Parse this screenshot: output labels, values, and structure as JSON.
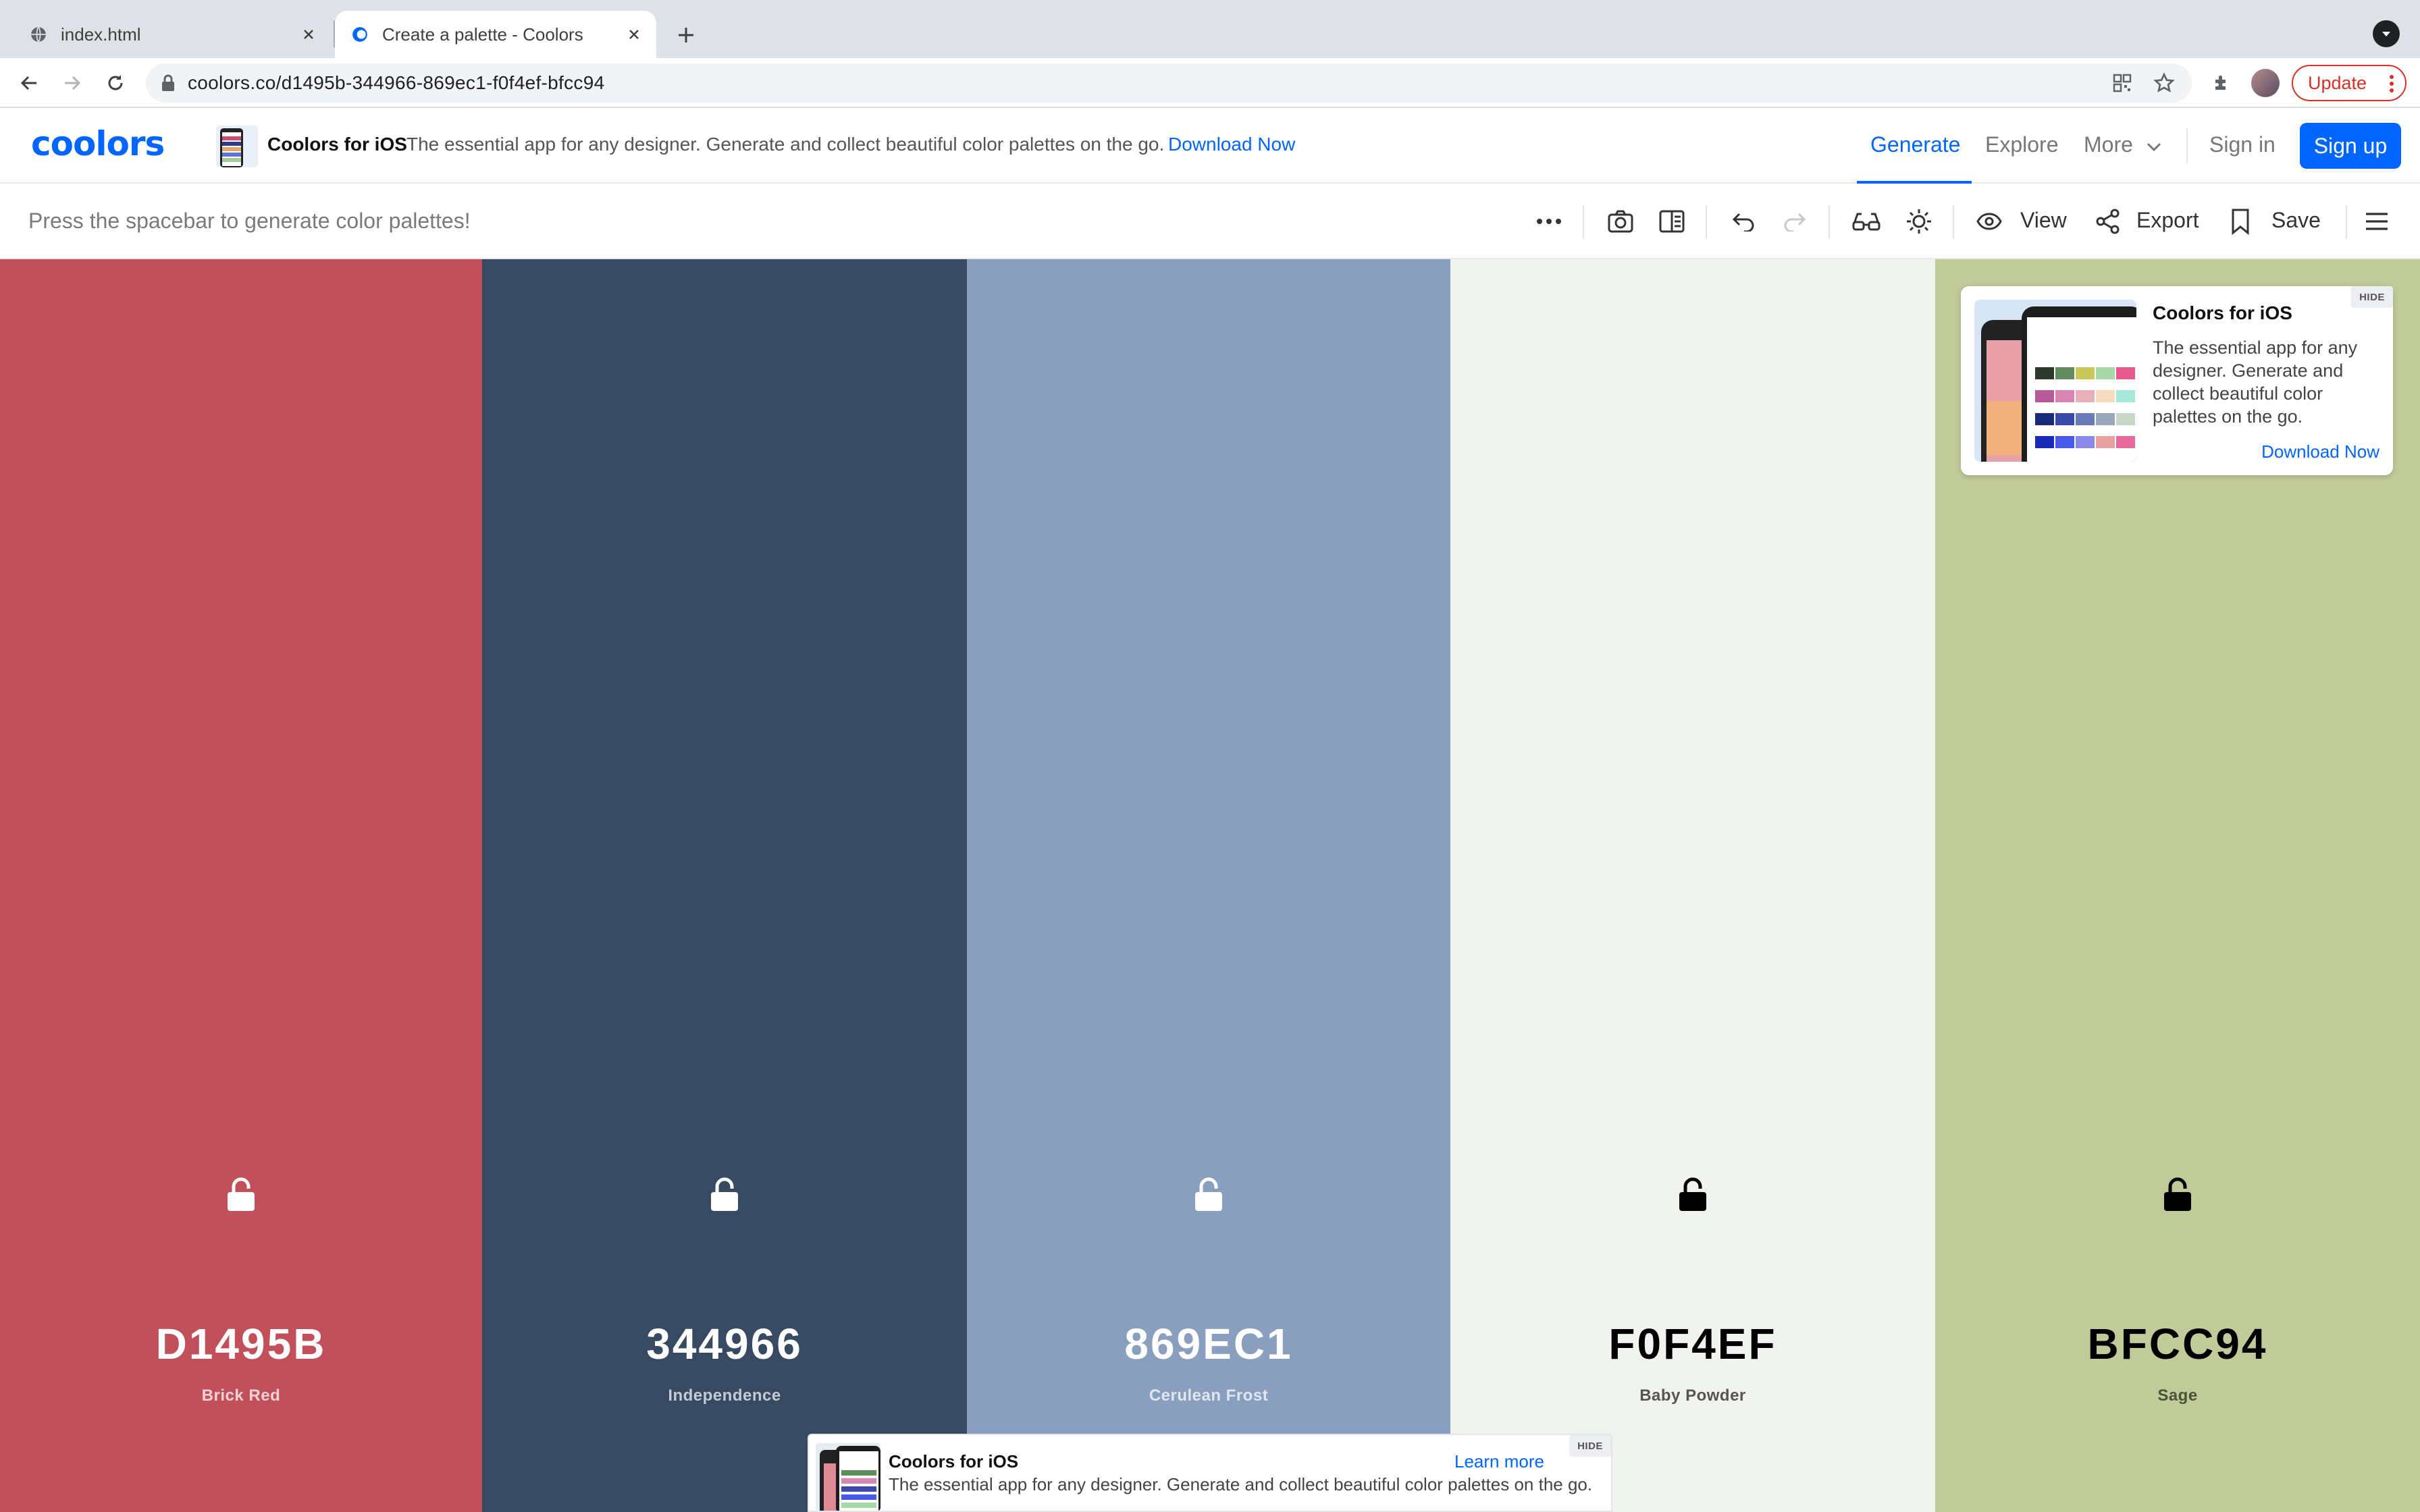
{
  "browser": {
    "tabs": [
      {
        "title": "index.html",
        "icon": "globe-icon",
        "active": false
      },
      {
        "title": "Create a palette - Coolors",
        "icon": "coolors-favicon",
        "active": true
      }
    ],
    "url": "coolors.co/d1495b-344966-869ec1-f0f4ef-bfcc94",
    "update_label": "Update"
  },
  "header": {
    "logo": "coolors",
    "promo": {
      "title": "Coolors for iOS",
      "description": "The essential app for any designer. Generate and collect beautiful color palettes on the go.",
      "link": "Download Now"
    },
    "nav": {
      "generate": "Generate",
      "explore": "Explore",
      "more": "More",
      "sign_in": "Sign in",
      "sign_up": "Sign up"
    },
    "accent_color": "#0066ff"
  },
  "toolbar": {
    "hint": "Press the spacebar to generate color palettes!",
    "view": "View",
    "export": "Export",
    "save": "Save"
  },
  "palette": [
    {
      "hex": "D1495B",
      "name": "Brick Red",
      "color": "#c2505b",
      "text_color": "#ffffff",
      "subtext_color": "#f1d2d5"
    },
    {
      "hex": "344966",
      "name": "Independence",
      "color": "#384962",
      "text_color": "#ffffff",
      "subtext_color": "#c4cbd6"
    },
    {
      "hex": "869EC1",
      "name": "Cerulean Frost",
      "color": "#8a9fbe",
      "text_color": "#ffffff",
      "subtext_color": "#dfe6f0"
    },
    {
      "hex": "F0F4EF",
      "name": "Baby Powder",
      "color": "#f1f3ef",
      "text_color": "#000000",
      "subtext_color": "#555555"
    },
    {
      "hex": "BFCC94",
      "name": "Sage",
      "color": "#c1ca99",
      "text_color": "#000000",
      "subtext_color": "#4b5236"
    }
  ],
  "side_ad": {
    "title": "Coolors for iOS",
    "description": "The essential app for any designer. Generate and collect beautiful color palettes on the go.",
    "link": "Download Now",
    "hide": "HIDE"
  },
  "bottom_ad": {
    "title": "Coolors for iOS",
    "description": "The essential app for any designer. Generate and collect beautiful color palettes on the go.",
    "link": "Learn more",
    "hide": "HIDE"
  }
}
